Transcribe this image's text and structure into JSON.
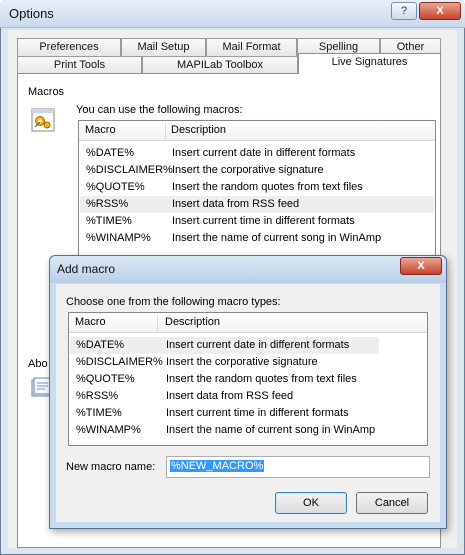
{
  "window": {
    "title": "Options",
    "help_label": "?",
    "close_label": "X"
  },
  "tabs_row1": [
    "Preferences",
    "Mail Setup",
    "Mail Format",
    "Spelling",
    "Other"
  ],
  "tabs_row2": [
    "Print Tools",
    "MAPILab Toolbox",
    "Live Signatures"
  ],
  "active_tab": "Live Signatures",
  "macros_section": {
    "label": "Macros",
    "intro": "You can use the following macros:",
    "columns": [
      "Macro",
      "Description"
    ],
    "rows": [
      {
        "macro": "%DATE%",
        "description": "Insert current date in different formats"
      },
      {
        "macro": "%DISCLAIMER%",
        "description": "Insert the corporative signature"
      },
      {
        "macro": "%QUOTE%",
        "description": "Insert the random quotes from text files"
      },
      {
        "macro": "%RSS%",
        "description": "Insert data from RSS feed"
      },
      {
        "macro": "%TIME%",
        "description": "Insert current time in different formats"
      },
      {
        "macro": "%WINAMP%",
        "description": "Insert the name of current song in WinAmp"
      }
    ],
    "selected_row": 3
  },
  "about_label": "Abo",
  "dialog": {
    "title": "Add macro",
    "close_label": "X",
    "intro": "Choose one from the following macro types:",
    "columns": [
      "Macro",
      "Description"
    ],
    "rows": [
      {
        "macro": "%DATE%",
        "description": "Insert current date in different formats"
      },
      {
        "macro": "%DISCLAIMER%",
        "description": "Insert the corporative signature"
      },
      {
        "macro": "%QUOTE%",
        "description": "Insert the random quotes from text files"
      },
      {
        "macro": "%RSS%",
        "description": "Insert data from RSS feed"
      },
      {
        "macro": "%TIME%",
        "description": "Insert current time in different formats"
      },
      {
        "macro": "%WINAMP%",
        "description": "Insert the name of current song in WinAmp"
      }
    ],
    "selected_row": 0,
    "name_label": "New macro name:",
    "name_value": "%NEW_MACRO%",
    "ok_label": "OK",
    "cancel_label": "Cancel"
  }
}
